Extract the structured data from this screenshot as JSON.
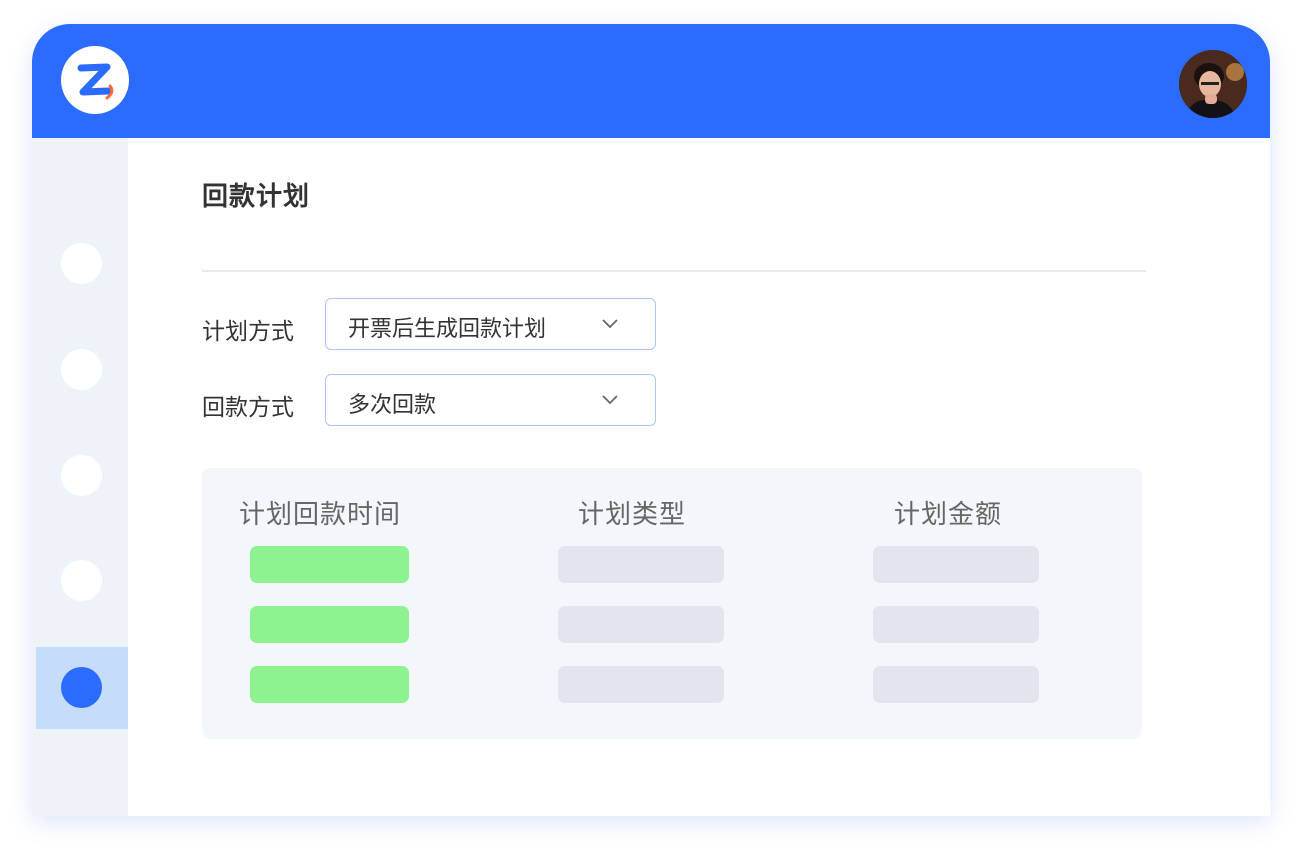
{
  "colors": {
    "accent": "#2b6cff",
    "success_placeholder": "#8df28f",
    "placeholder": "#e1e6ee"
  },
  "header": {
    "logo_icon": "z-logo-icon",
    "avatar_icon": "user-avatar"
  },
  "sidebar": {
    "items": [
      {
        "icon": "nav-dot-icon",
        "active": false
      },
      {
        "icon": "nav-dot-icon",
        "active": false
      },
      {
        "icon": "nav-dot-icon",
        "active": false
      },
      {
        "icon": "nav-dot-icon",
        "active": false
      },
      {
        "icon": "nav-dot-icon",
        "active": true
      }
    ]
  },
  "main": {
    "title": "回款计划",
    "form": {
      "plan_method": {
        "label": "计划方式",
        "value": "开票后生成回款计划"
      },
      "payment_method": {
        "label": "回款方式",
        "value": "多次回款"
      }
    },
    "table": {
      "columns": [
        "计划回款时间",
        "计划类型",
        "计划金额"
      ],
      "row_count": 3
    }
  }
}
